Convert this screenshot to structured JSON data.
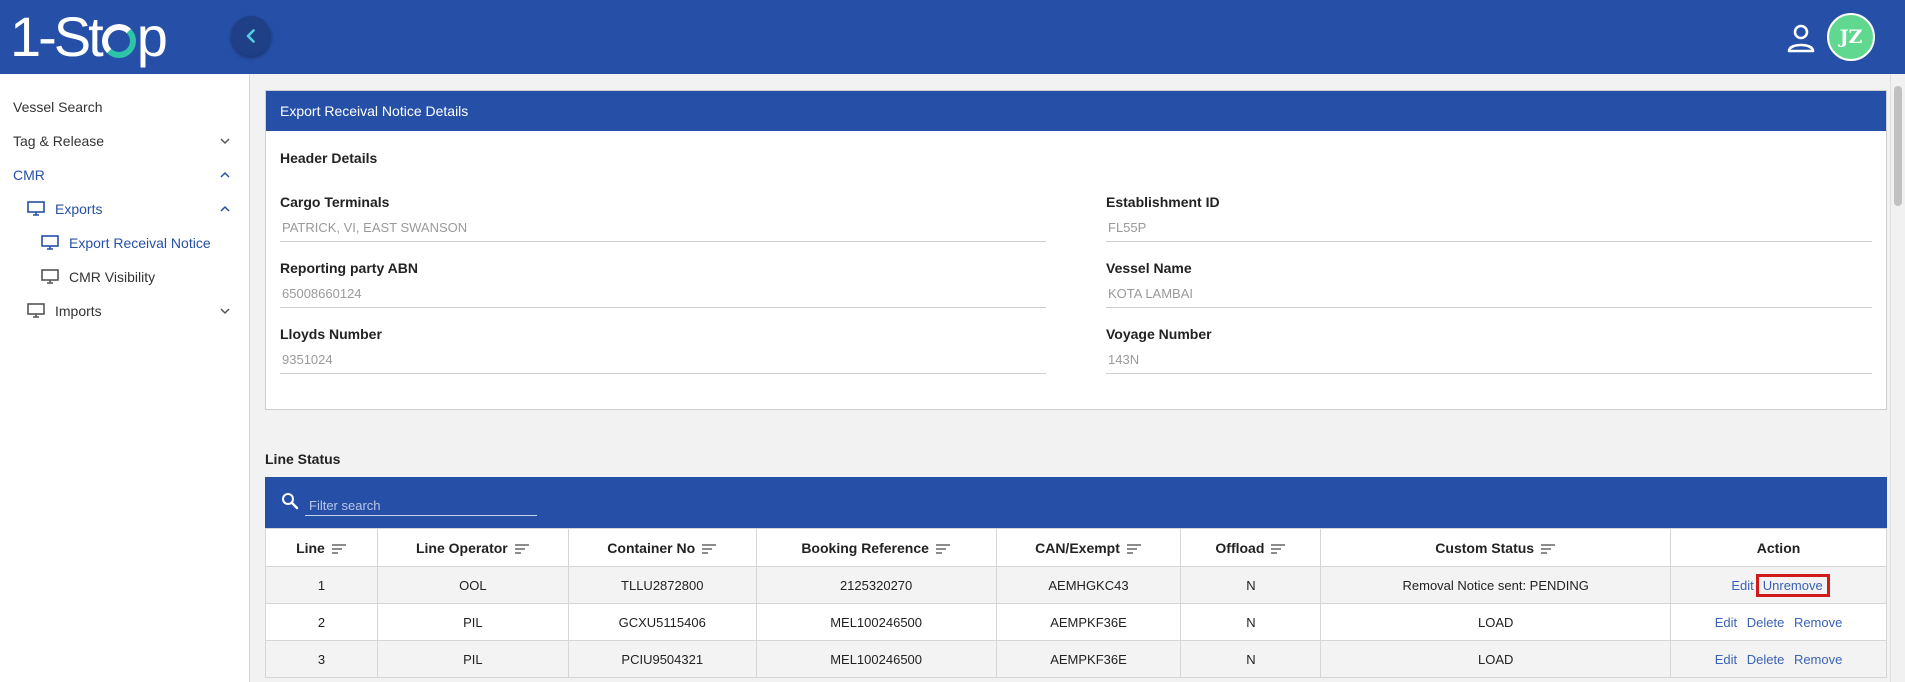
{
  "app": {
    "logo_left": "1-St",
    "logo_right": "p"
  },
  "header": {
    "avatar_initials": "JZ"
  },
  "sidebar": {
    "items": [
      {
        "label": "Vessel Search"
      },
      {
        "label": "Tag & Release"
      },
      {
        "label": "CMR"
      },
      {
        "label": "Exports"
      },
      {
        "label": "Export Receival Notice"
      },
      {
        "label": "CMR Visibility"
      },
      {
        "label": "Imports"
      }
    ]
  },
  "card": {
    "title": "Export Receival Notice Details",
    "section": "Header Details",
    "fields": {
      "cargo_terminals": {
        "label": "Cargo Terminals",
        "value": "PATRICK, VI, EAST SWANSON"
      },
      "establishment_id": {
        "label": "Establishment ID",
        "value": "FL55P"
      },
      "reporting_abn": {
        "label": "Reporting party ABN",
        "value": "65008660124"
      },
      "vessel_name": {
        "label": "Vessel Name",
        "value": "KOTA LAMBAI"
      },
      "lloyds_number": {
        "label": "Lloyds Number",
        "value": "9351024"
      },
      "voyage_number": {
        "label": "Voyage Number",
        "value": "143N"
      }
    }
  },
  "line_status": {
    "title": "Line Status",
    "filter_placeholder": "Filter search",
    "columns": [
      "Line",
      "Line Operator",
      "Container No",
      "Booking Reference",
      "CAN/Exempt",
      "Offload",
      "Custom Status",
      "Action"
    ],
    "rows": [
      {
        "line": "1",
        "operator": "OOL",
        "container": "TLLU2872800",
        "booking": "2125320270",
        "can": "AEMHGKC43",
        "offload": "N",
        "status": "Removal Notice sent: PENDING",
        "actions": [
          "Edit",
          "Unremove"
        ]
      },
      {
        "line": "2",
        "operator": "PIL",
        "container": "GCXU5115406",
        "booking": "MEL100246500",
        "can": "AEMPKF36E",
        "offload": "N",
        "status": "LOAD",
        "actions": [
          "Edit",
          "Delete",
          "Remove"
        ]
      },
      {
        "line": "3",
        "operator": "PIL",
        "container": "PCIU9504321",
        "booking": "MEL100246500",
        "can": "AEMPKF36E",
        "offload": "N",
        "status": "LOAD",
        "actions": [
          "Edit",
          "Delete",
          "Remove"
        ]
      }
    ]
  },
  "colors": {
    "primary": "#2650a8",
    "link": "#3a62b8",
    "highlight": "#d11a1a",
    "avatar": "#60d890"
  },
  "icons": [
    "chevron-left-icon",
    "user-icon",
    "chevron-down-icon",
    "chevron-up-icon",
    "monitor-icon",
    "search-icon",
    "sort-icon"
  ]
}
